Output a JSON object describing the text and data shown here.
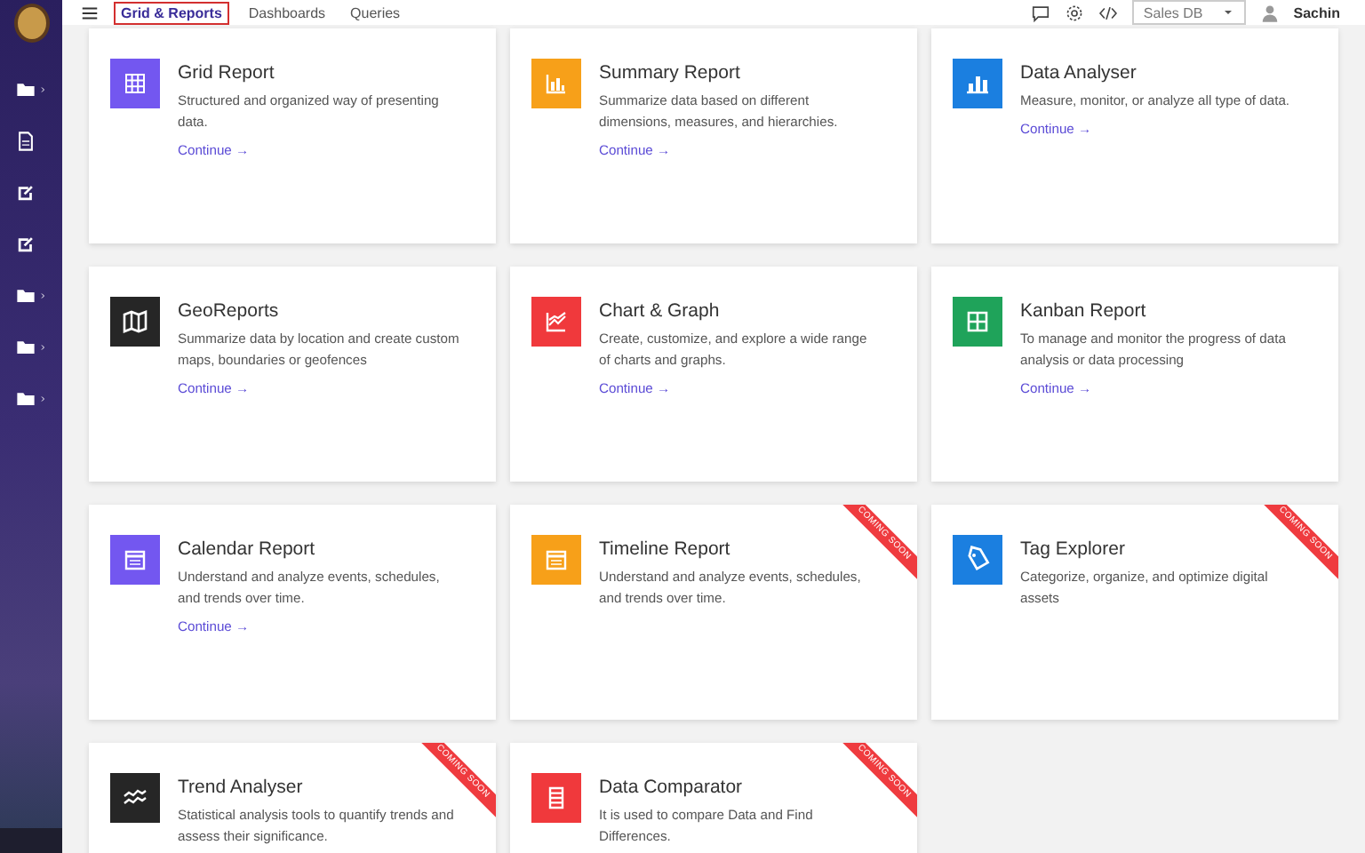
{
  "header": {
    "tabs": [
      {
        "label": "Grid & Reports",
        "selected": true
      },
      {
        "label": "Dashboards",
        "selected": false
      },
      {
        "label": "Queries",
        "selected": false
      }
    ],
    "database": "Sales DB",
    "user": "Sachin"
  },
  "sidebar": {
    "items": [
      {
        "kind": "folder",
        "has_children": true
      },
      {
        "kind": "file",
        "has_children": false
      },
      {
        "kind": "edit",
        "has_children": false
      },
      {
        "kind": "edit",
        "has_children": false
      },
      {
        "kind": "folder",
        "has_children": true
      },
      {
        "kind": "folder",
        "has_children": true
      },
      {
        "kind": "folder",
        "has_children": true
      }
    ]
  },
  "cards": [
    {
      "kind": "grid",
      "title": "Grid Report",
      "description": "Structured and organized way of presenting data.",
      "color": "#7357f0",
      "link": "Continue →"
    },
    {
      "kind": "summary",
      "title": "Summary Report",
      "description": "Summarize data based on different dimensions, measures, and hierarchies.",
      "color": "#f7a019",
      "link": "Continue →"
    },
    {
      "kind": "bars",
      "title": "Data Analyser",
      "description": "Measure, monitor, or analyze all type of data.",
      "color": "#1b7fe0",
      "link": "Continue →"
    },
    {
      "kind": "map",
      "title": "GeoReports",
      "description": "Summarize data by location and create custom maps, boundaries or geofences",
      "color": "#262626",
      "link": "Continue →"
    },
    {
      "kind": "chart",
      "title": "Chart & Graph",
      "description": "Create, customize, and explore a wide range of charts and graphs.",
      "color": "#f0393c",
      "link": "Continue →"
    },
    {
      "kind": "kanban",
      "title": "Kanban Report",
      "description": "To manage and monitor the progress of data analysis or data processing",
      "color": "#1fa35a",
      "link": "Continue →"
    },
    {
      "kind": "calendar",
      "title": "Calendar Report",
      "description": "Understand and analyze events, schedules, and trends over time.",
      "color": "#7357f0",
      "link": "Continue →"
    },
    {
      "kind": "calendar",
      "title": "Timeline Report",
      "description": "Understand and analyze events, schedules, and trends over time.",
      "color": "#f7a019",
      "ribbon": "COMING SOON"
    },
    {
      "kind": "tag",
      "title": "Tag Explorer",
      "description": "Categorize, organize, and optimize digital assets",
      "color": "#1b7fe0",
      "ribbon": "COMING SOON"
    },
    {
      "kind": "trend",
      "title": "Trend Analyser",
      "description": "Statistical analysis tools to quantify trends and assess their significance.",
      "color": "#262626",
      "ribbon": "COMING SOON"
    },
    {
      "kind": "list",
      "title": "Data Comparator",
      "description": "It is used to compare Data and Find Differences.",
      "color": "#f0393c",
      "ribbon": "COMING SOON"
    }
  ]
}
